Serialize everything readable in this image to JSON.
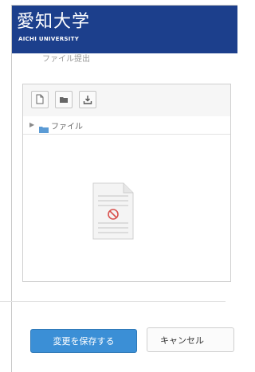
{
  "header": {
    "logo_jp": "愛知大学",
    "logo_en": "AICHI UNIVERSITY"
  },
  "section": {
    "title": "ファイル提出"
  },
  "filepicker": {
    "toolbar": {
      "icons": [
        "add-file-icon",
        "create-folder-icon",
        "download-icon"
      ]
    },
    "path_label": "ファイル"
  },
  "footer": {
    "save_label": "変更を保存する",
    "cancel_label": "キャンセル"
  },
  "colors": {
    "header_bg": "#1c3f8c",
    "primary_button": "#3b8fd6"
  }
}
